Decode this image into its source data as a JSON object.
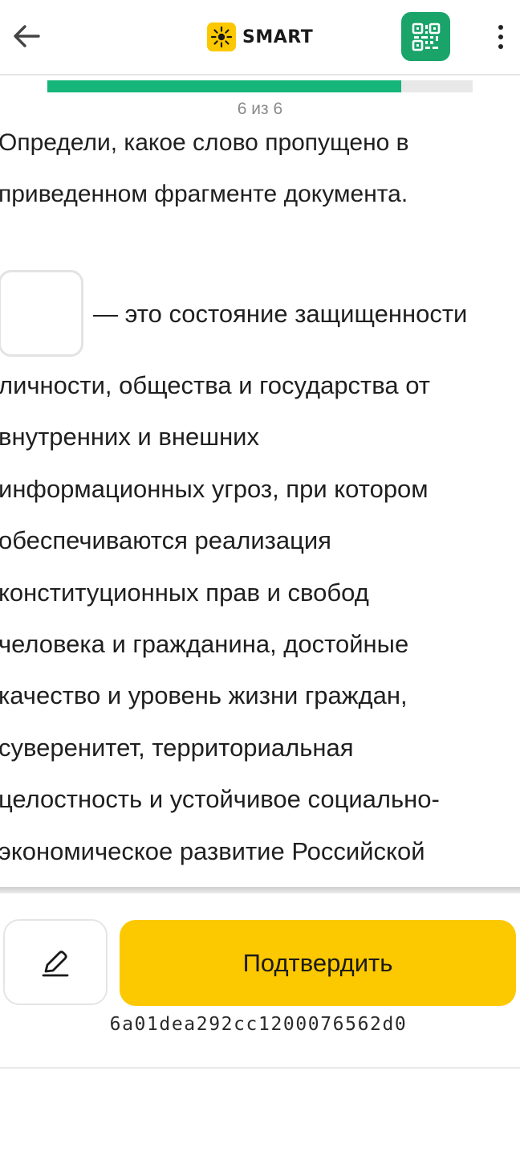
{
  "header": {
    "back_icon": "arrow-left-icon",
    "brand_name": "SMART",
    "brand_icon": "sun-icon",
    "brand_color": "#fcc800",
    "qr_icon": "qr-code-icon",
    "qr_color": "#1aa46a",
    "menu_icon": "more-vertical-icon"
  },
  "progress": {
    "label": "6 из 6",
    "fill_fraction": 0.833,
    "color": "#16b57a"
  },
  "question": {
    "prompt_line1": "Определи, какое слово пропущено в",
    "prompt_line2": "приведенном фрагменте документа.",
    "first_line": "— это состояние защищенности",
    "lines": [
      "личности, общества и государства от",
      "внутренних и внешних",
      "информационных угроз, при котором",
      "обеспечиваются реализация",
      "конституционных прав и свобод",
      "человека и гражданина, достойные",
      "качество и уровень жизни граждан,",
      "суверенитет, территориальная",
      "целостность и устойчивое социально-",
      "экономическое развитие Российской"
    ]
  },
  "footer": {
    "edit_icon": "pencil-icon",
    "confirm_label": "Подтвердить",
    "confirm_color": "#fcc800",
    "hash": "6a01dea292cc1200076562d0"
  }
}
